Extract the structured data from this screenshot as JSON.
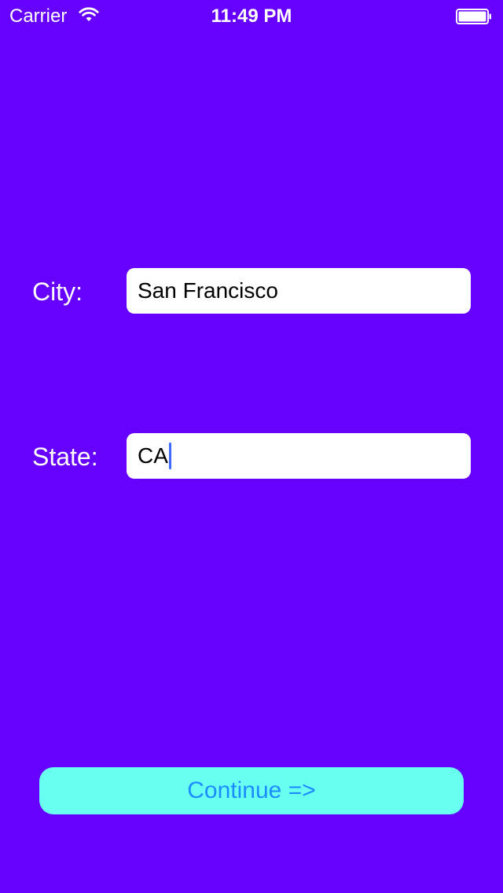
{
  "status_bar": {
    "carrier": "Carrier",
    "time": "11:49 PM",
    "wifi_icon": "wifi-icon",
    "battery_icon": "battery-icon"
  },
  "form": {
    "city": {
      "label": "City:",
      "value": "San Francisco"
    },
    "state": {
      "label": "State:",
      "value": "CA"
    }
  },
  "continue_button": {
    "label": "Continue =>"
  },
  "colors": {
    "background": "#6600ff",
    "button_background": "#69fff0",
    "button_text": "#1a8cff",
    "caret": "#3f6bff"
  }
}
